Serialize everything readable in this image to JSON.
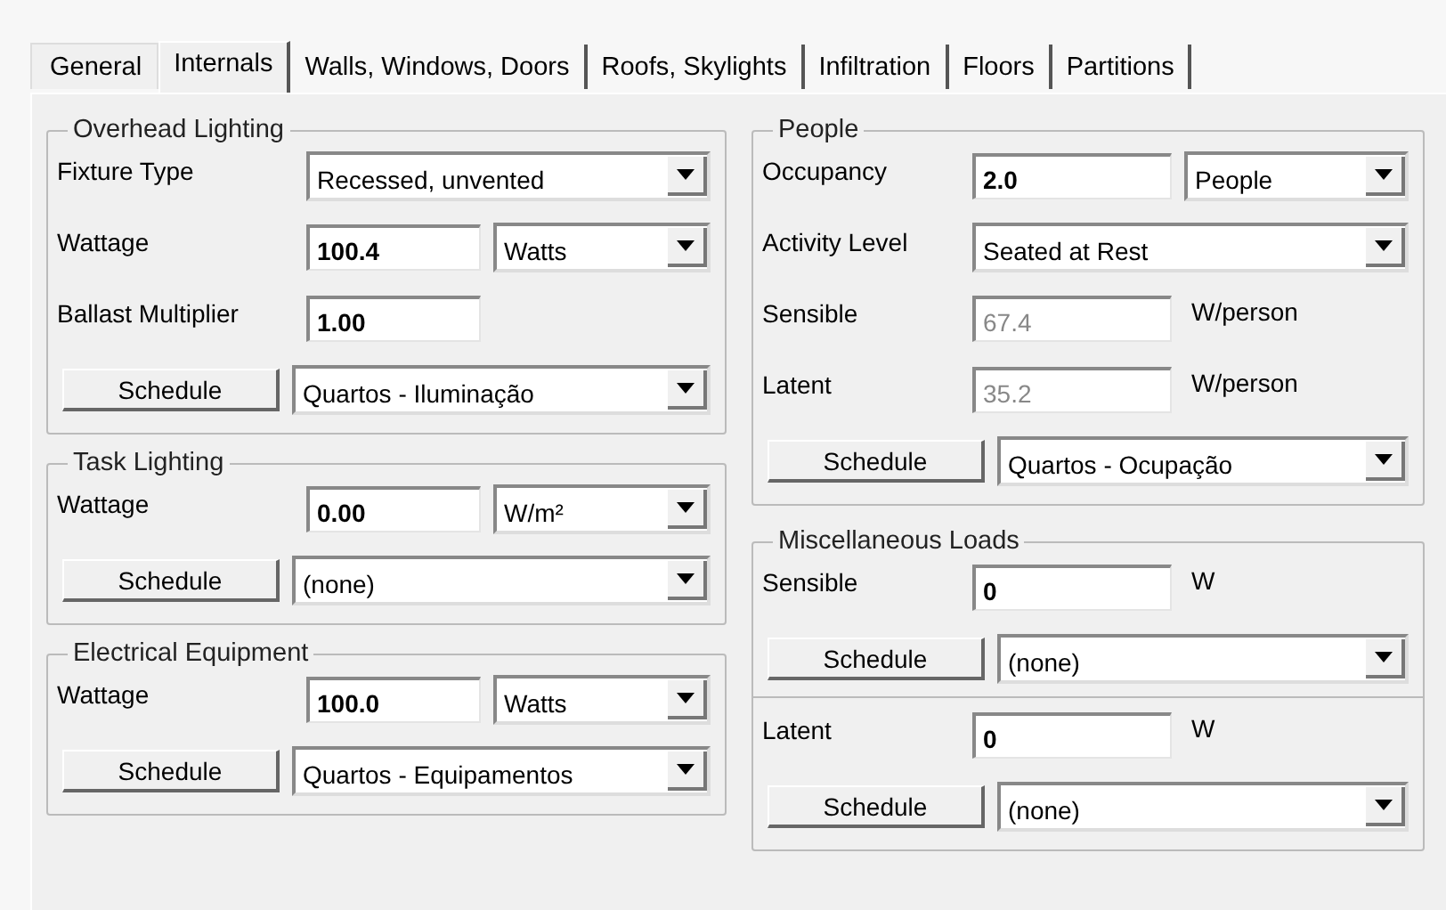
{
  "tabs": [
    {
      "label": "General",
      "selected": false
    },
    {
      "label": "Internals",
      "selected": true
    },
    {
      "label": "Walls, Windows, Doors",
      "selected": false
    },
    {
      "label": "Roofs, Skylights",
      "selected": false
    },
    {
      "label": "Infiltration",
      "selected": false
    },
    {
      "label": "Floors",
      "selected": false
    },
    {
      "label": "Partitions",
      "selected": false
    }
  ],
  "left_groups": [
    {
      "title": "Overhead Lighting",
      "rows": [
        {
          "kind": "select",
          "label": "Fixture Type",
          "value": "Recessed, unvented"
        },
        {
          "kind": "field",
          "label": "Wattage",
          "value": "100.4",
          "disabled": false,
          "unit_select": "Watts"
        },
        {
          "kind": "field",
          "label": "Ballast Multiplier",
          "value": "1.00",
          "disabled": false
        },
        {
          "kind": "schedule",
          "button": "Schedule",
          "value": "Quartos - Iluminação"
        }
      ]
    },
    {
      "title": "Task Lighting",
      "rows": [
        {
          "kind": "field",
          "label": "Wattage",
          "value": "0.00",
          "disabled": false,
          "unit_select": "W/m²"
        },
        {
          "kind": "schedule",
          "button": "Schedule",
          "value": "(none)"
        }
      ]
    },
    {
      "title": "Electrical Equipment",
      "rows": [
        {
          "kind": "field",
          "label": "Wattage",
          "value": "100.0",
          "disabled": false,
          "unit_select": "Watts"
        },
        {
          "kind": "schedule",
          "button": "Schedule",
          "value": "Quartos - Equipamentos"
        }
      ]
    }
  ],
  "right_groups": [
    {
      "title": "People",
      "rows": [
        {
          "kind": "field",
          "label": "Occupancy",
          "value": "2.0",
          "disabled": false,
          "unit_select": "People"
        },
        {
          "kind": "select",
          "label": "Activity Level",
          "value": "Seated at Rest"
        },
        {
          "kind": "field",
          "label": "Sensible",
          "value": "67.4",
          "disabled": true,
          "unit": "W/person"
        },
        {
          "kind": "field",
          "label": "Latent",
          "value": "35.2",
          "disabled": true,
          "unit": "W/person"
        },
        {
          "kind": "schedule",
          "button": "Schedule",
          "value": "Quartos - Ocupação"
        }
      ]
    },
    {
      "title": "Miscellaneous Loads",
      "rows": [
        {
          "kind": "field",
          "label": "Sensible",
          "value": "0",
          "disabled": false,
          "unit": "W"
        },
        {
          "kind": "schedule",
          "button": "Schedule",
          "value": "(none)"
        },
        {
          "kind": "divider"
        },
        {
          "kind": "field",
          "label": "Latent",
          "value": "0",
          "disabled": false,
          "unit": "W"
        },
        {
          "kind": "schedule",
          "button": "Schedule",
          "value": "(none)"
        }
      ]
    }
  ]
}
